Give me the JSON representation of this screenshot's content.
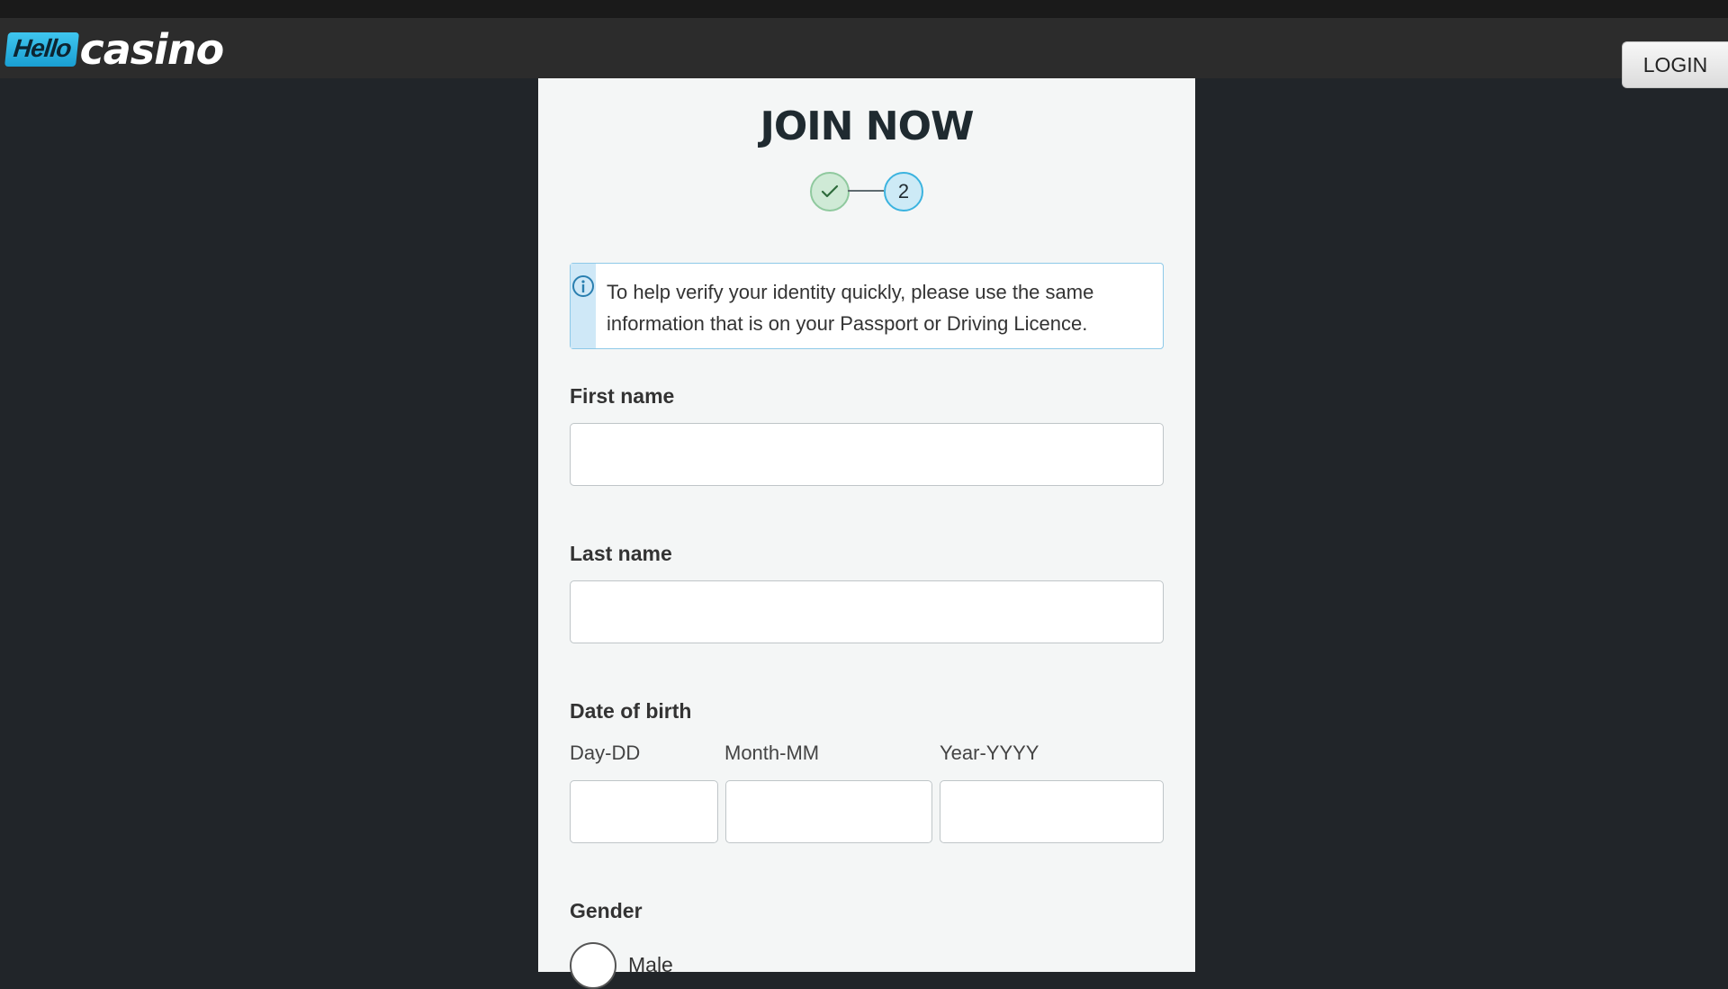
{
  "header": {
    "logo_hello": "Hello",
    "logo_casino": "casino",
    "login_label": "LOGIN"
  },
  "form": {
    "title": "JOIN NOW",
    "stepper": {
      "step1_state": "completed",
      "step2_label": "2"
    },
    "info_message": "To help verify your identity quickly, please use the same information that is on your Passport or Driving Licence.",
    "first_name": {
      "label": "First name",
      "value": ""
    },
    "last_name": {
      "label": "Last name",
      "value": ""
    },
    "date_of_birth": {
      "label": "Date of birth",
      "day_label": "Day-DD",
      "month_label": "Month-MM",
      "year_label": "Year-YYYY",
      "day_value": "",
      "month_value": "",
      "year_value": ""
    },
    "gender": {
      "label": "Gender",
      "options": [
        "Male"
      ]
    }
  },
  "colors": {
    "page_background": "#212529",
    "header_background": "#2c2c2c",
    "card_background": "#f4f6f6",
    "accent_blue": "#3bb3df",
    "success_green": "#8fc99e"
  },
  "icons": {
    "step1": "check-icon",
    "info": "info-icon"
  }
}
